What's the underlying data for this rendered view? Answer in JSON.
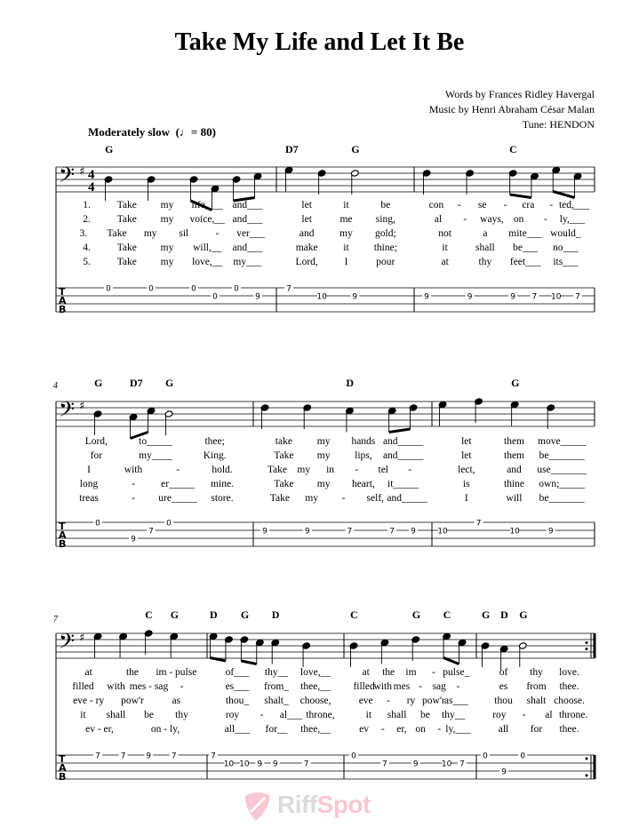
{
  "title": "Take My Life and Let It Be",
  "credits": {
    "words": "Words by Frances Ridley Havergal",
    "music": "Music by Henri Abraham César Malan",
    "tune": "Tune: HENDON"
  },
  "tempo": {
    "label": "Moderately slow",
    "bpm_text": "= 80",
    "bpm": 80
  },
  "clef": "bass",
  "key_signature": "G major (1 sharp)",
  "time_signature": "4/4",
  "tab_label": [
    "T",
    "A",
    "B"
  ],
  "watermark": {
    "part1": "Riff",
    "part2": "Spot"
  },
  "systems": [
    {
      "measure_number": "",
      "chords": [
        {
          "label": "G",
          "measure": 0,
          "beat": 0
        },
        {
          "label": "D7",
          "measure": 1,
          "beat": 0
        },
        {
          "label": "G",
          "measure": 1,
          "beat": 2
        },
        {
          "label": "C",
          "measure": 2,
          "beat": 2
        }
      ],
      "measures": [
        {
          "notes": [
            {
              "pitch": "G3",
              "dur": "q",
              "beat": 0
            },
            {
              "pitch": "G3",
              "dur": "q",
              "beat": 1
            },
            {
              "pitch": "G3",
              "dur": "e",
              "beat": 2
            },
            {
              "pitch": "D3",
              "dur": "e",
              "beat": 2.5
            },
            {
              "pitch": "G3",
              "dur": "e",
              "beat": 3
            },
            {
              "pitch": "A3",
              "dur": "e",
              "beat": 3.5
            }
          ],
          "tab": [
            {
              "string": 1,
              "fret": "0",
              "beat": 0
            },
            {
              "string": 1,
              "fret": "0",
              "beat": 1
            },
            {
              "string": 1,
              "fret": "0",
              "beat": 2
            },
            {
              "string": 2,
              "fret": "0",
              "beat": 2.5
            },
            {
              "string": 1,
              "fret": "0",
              "beat": 3
            },
            {
              "string": 2,
              "fret": "9",
              "beat": 3.5
            }
          ],
          "lyrics": [
            [
              "1.",
              "Take",
              "my",
              "life,___",
              "and___"
            ],
            [
              "2.",
              "Take",
              "my",
              "voice,__",
              "and___"
            ],
            [
              "3.",
              "Take",
              "my",
              "sil",
              "-",
              "ver___"
            ],
            [
              "4.",
              "Take",
              "my",
              "will,__",
              "and___"
            ],
            [
              "5.",
              "Take",
              "my",
              "love,__",
              "my___"
            ]
          ]
        },
        {
          "notes": [
            {
              "pitch": "C4",
              "dur": "q",
              "beat": 0
            },
            {
              "pitch": "B3",
              "dur": "q",
              "beat": 1
            },
            {
              "pitch": "B3",
              "dur": "h",
              "beat": 2
            }
          ],
          "tab": [
            {
              "string": 1,
              "fret": "7",
              "beat": 0
            },
            {
              "string": 2,
              "fret": "10",
              "beat": 1
            },
            {
              "string": 2,
              "fret": "9",
              "beat": 2
            }
          ],
          "lyrics": [
            [
              "let",
              "it",
              "be"
            ],
            [
              "let",
              "me",
              "sing,"
            ],
            [
              "and",
              "my",
              "gold;"
            ],
            [
              "make",
              "it",
              "thine;"
            ],
            [
              "Lord,",
              "I",
              "pour"
            ]
          ]
        },
        {
          "notes": [
            {
              "pitch": "B3",
              "dur": "q",
              "beat": 0
            },
            {
              "pitch": "B3",
              "dur": "q",
              "beat": 1
            },
            {
              "pitch": "B3",
              "dur": "e",
              "beat": 2
            },
            {
              "pitch": "A3",
              "dur": "e",
              "beat": 2.5
            },
            {
              "pitch": "C4",
              "dur": "e",
              "beat": 3
            },
            {
              "pitch": "A3",
              "dur": "e",
              "beat": 3.5
            }
          ],
          "tab": [
            {
              "string": 2,
              "fret": "9",
              "beat": 0
            },
            {
              "string": 2,
              "fret": "9",
              "beat": 1
            },
            {
              "string": 2,
              "fret": "9",
              "beat": 2
            },
            {
              "string": 2,
              "fret": "7",
              "beat": 2.5
            },
            {
              "string": 2,
              "fret": "10",
              "beat": 3
            },
            {
              "string": 2,
              "fret": "7",
              "beat": 3.5
            }
          ],
          "lyrics": [
            [
              "con",
              "-",
              "se",
              "-",
              "cra",
              "-",
              "ted,___"
            ],
            [
              "al",
              "-",
              "ways,",
              "on",
              "-",
              "ly,___"
            ],
            [
              "not",
              "a",
              "mite___",
              "would_"
            ],
            [
              "it",
              "shall",
              "be___",
              "no___"
            ],
            [
              "at",
              "thy",
              "feet___",
              "its___"
            ]
          ]
        }
      ]
    },
    {
      "measure_number": "4",
      "chords": [
        {
          "label": "G",
          "measure": 0,
          "beat": 0
        },
        {
          "label": "D7",
          "measure": 0,
          "beat": 1
        },
        {
          "label": "G",
          "measure": 0,
          "beat": 2
        },
        {
          "label": "D",
          "measure": 1,
          "beat": 2
        },
        {
          "label": "G",
          "measure": 2,
          "beat": 2
        }
      ],
      "measures": [
        {
          "notes": [
            {
              "pitch": "G3",
              "dur": "q",
              "beat": 0
            },
            {
              "pitch": "F#3",
              "dur": "e",
              "beat": 1
            },
            {
              "pitch": "A3",
              "dur": "e",
              "beat": 1.5
            },
            {
              "pitch": "G3",
              "dur": "h",
              "beat": 2
            }
          ],
          "tab": [
            {
              "string": 1,
              "fret": "0",
              "beat": 0
            },
            {
              "string": 3,
              "fret": "9",
              "beat": 1
            },
            {
              "string": 2,
              "fret": "7",
              "beat": 1.5
            },
            {
              "string": 1,
              "fret": "0",
              "beat": 2
            }
          ],
          "lyrics": [
            [
              "Lord,",
              "to_____",
              "thee;"
            ],
            [
              "for",
              "my____",
              "King."
            ],
            [
              "I",
              "with",
              "-",
              "hold."
            ],
            [
              "long",
              "-",
              "er_____",
              "mine."
            ],
            [
              "treas",
              "-",
              "ure_____",
              "store."
            ]
          ]
        },
        {
          "notes": [
            {
              "pitch": "B3",
              "dur": "q",
              "beat": 0
            },
            {
              "pitch": "B3",
              "dur": "q",
              "beat": 1
            },
            {
              "pitch": "A3",
              "dur": "q",
              "beat": 2
            },
            {
              "pitch": "A3",
              "dur": "e",
              "beat": 3
            },
            {
              "pitch": "B3",
              "dur": "e",
              "beat": 3.5
            }
          ],
          "tab": [
            {
              "string": 2,
              "fret": "9",
              "beat": 0
            },
            {
              "string": 2,
              "fret": "9",
              "beat": 1
            },
            {
              "string": 2,
              "fret": "7",
              "beat": 2
            },
            {
              "string": 2,
              "fret": "7",
              "beat": 3
            },
            {
              "string": 2,
              "fret": "9",
              "beat": 3.5
            }
          ],
          "lyrics": [
            [
              "take",
              "my",
              "hands",
              "and_____"
            ],
            [
              "Take",
              "my",
              "lips,",
              "and_____"
            ],
            [
              "Take",
              "my",
              "in",
              "-",
              "tel",
              "-"
            ],
            [
              "Take",
              "my",
              "heart,",
              "it_____"
            ],
            [
              "Take",
              "my",
              "-",
              "self,",
              "and_____"
            ]
          ]
        },
        {
          "notes": [
            {
              "pitch": "C4",
              "dur": "q",
              "beat": 0
            },
            {
              "pitch": "D4",
              "dur": "q",
              "beat": 1
            },
            {
              "pitch": "C4",
              "dur": "q",
              "beat": 2
            },
            {
              "pitch": "B3",
              "dur": "q",
              "beat": 3
            }
          ],
          "tab": [
            {
              "string": 2,
              "fret": "10",
              "beat": 0
            },
            {
              "string": 1,
              "fret": "7",
              "beat": 1
            },
            {
              "string": 2,
              "fret": "10",
              "beat": 2
            },
            {
              "string": 2,
              "fret": "9",
              "beat": 3
            }
          ],
          "lyrics": [
            [
              "let",
              "them",
              "move_____"
            ],
            [
              "let",
              "them",
              "be_______"
            ],
            [
              "lect,",
              "and",
              "use_______"
            ],
            [
              "is",
              "thine",
              "own;_____"
            ],
            [
              "I",
              "will",
              "be_______"
            ]
          ]
        }
      ]
    },
    {
      "measure_number": "7",
      "chords": [
        {
          "label": "C",
          "measure": 0,
          "beat": 2
        },
        {
          "label": "G",
          "measure": 0,
          "beat": 3
        },
        {
          "label": "D",
          "measure": 1,
          "beat": 0
        },
        {
          "label": "G",
          "measure": 1,
          "beat": 1
        },
        {
          "label": "D",
          "measure": 1,
          "beat": 2
        },
        {
          "label": "C",
          "measure": 2,
          "beat": 0
        },
        {
          "label": "G",
          "measure": 2,
          "beat": 2
        },
        {
          "label": "C",
          "measure": 2,
          "beat": 3
        },
        {
          "label": "G",
          "measure": 3,
          "beat": 0
        },
        {
          "label": "D",
          "measure": 3,
          "beat": 1
        },
        {
          "label": "G",
          "measure": 3,
          "beat": 2
        }
      ],
      "measures": [
        {
          "notes": [
            {
              "pitch": "C4",
              "dur": "q",
              "beat": 0
            },
            {
              "pitch": "C4",
              "dur": "q",
              "beat": 1
            },
            {
              "pitch": "D4",
              "dur": "q",
              "beat": 2
            },
            {
              "pitch": "C4",
              "dur": "q",
              "beat": 3
            }
          ],
          "tab": [
            {
              "string": 1,
              "fret": "7",
              "beat": 0
            },
            {
              "string": 1,
              "fret": "7",
              "beat": 1
            },
            {
              "string": 1,
              "fret": "9",
              "beat": 2
            },
            {
              "string": 1,
              "fret": "7",
              "beat": 3
            }
          ],
          "lyrics": [
            [
              "at",
              "the",
              "im - pulse"
            ],
            [
              "filled",
              "with",
              "mes - sag",
              "-"
            ],
            [
              "eve - ry",
              "pow'r",
              "as"
            ],
            [
              "it",
              "shall",
              "be",
              "thy"
            ],
            [
              "ev - er,",
              "on - ly,"
            ]
          ]
        },
        {
          "notes": [
            {
              "pitch": "C4",
              "dur": "e",
              "beat": 0
            },
            {
              "pitch": "B3",
              "dur": "e",
              "beat": 0.5
            },
            {
              "pitch": "B3",
              "dur": "e",
              "beat": 1
            },
            {
              "pitch": "A3",
              "dur": "e",
              "beat": 1.5
            },
            {
              "pitch": "A3",
              "dur": "q",
              "beat": 2
            },
            {
              "pitch": "G3",
              "dur": "q",
              "beat": 3
            }
          ],
          "tab": [
            {
              "string": 1,
              "fret": "7",
              "beat": 0
            },
            {
              "string": 2,
              "fret": "10",
              "beat": 0.5
            },
            {
              "string": 2,
              "fret": "10",
              "beat": 1
            },
            {
              "string": 2,
              "fret": "9",
              "beat": 1.5
            },
            {
              "string": 2,
              "fret": "9",
              "beat": 2
            },
            {
              "string": 2,
              "fret": "7",
              "beat": 3
            }
          ],
          "lyrics": [
            [
              "of___",
              "thy__",
              "love,__"
            ],
            [
              "es___",
              "from_",
              "thee,__"
            ],
            [
              "thou_",
              "shalt_",
              "choose,"
            ],
            [
              "roy",
              "-",
              "al___",
              "throne,"
            ],
            [
              "all___",
              "for__",
              "thee,__"
            ]
          ]
        },
        {
          "notes": [
            {
              "pitch": "G3",
              "dur": "q",
              "beat": 0
            },
            {
              "pitch": "A3",
              "dur": "q",
              "beat": 1
            },
            {
              "pitch": "B3",
              "dur": "q",
              "beat": 2
            },
            {
              "pitch": "C4",
              "dur": "e",
              "beat": 3
            },
            {
              "pitch": "A3",
              "dur": "e",
              "beat": 3.5
            }
          ],
          "tab": [
            {
              "string": 1,
              "fret": "0",
              "beat": 0
            },
            {
              "string": 2,
              "fret": "7",
              "beat": 1
            },
            {
              "string": 2,
              "fret": "9",
              "beat": 2
            },
            {
              "string": 2,
              "fret": "10",
              "beat": 3
            },
            {
              "string": 2,
              "fret": "7",
              "beat": 3.5
            }
          ],
          "lyrics": [
            [
              "at",
              "the",
              "im",
              "-",
              "pulse_"
            ],
            [
              "filled",
              "with",
              "mes",
              "-",
              "sag",
              "-"
            ],
            [
              "eve",
              "-",
              "ry",
              "pow'r",
              "as___"
            ],
            [
              "it",
              "shall",
              "be",
              "thy__"
            ],
            [
              "ev",
              "-",
              "er,",
              "on",
              "-",
              "ly,___"
            ]
          ]
        },
        {
          "notes": [
            {
              "pitch": "G3",
              "dur": "q",
              "beat": 0
            },
            {
              "pitch": "F#3",
              "dur": "q",
              "beat": 1
            },
            {
              "pitch": "G3",
              "dur": "h",
              "beat": 2
            }
          ],
          "tab": [
            {
              "string": 1,
              "fret": "0",
              "beat": 0
            },
            {
              "string": 3,
              "fret": "9",
              "beat": 1
            },
            {
              "string": 1,
              "fret": "0",
              "beat": 2
            }
          ],
          "lyrics": [
            [
              "of",
              "thy",
              "love."
            ],
            [
              "es",
              "from",
              "thee."
            ],
            [
              "thou",
              "shalt",
              "choose."
            ],
            [
              "roy",
              "-",
              "al",
              "throne."
            ],
            [
              "all",
              "for",
              "thee."
            ]
          ]
        }
      ]
    }
  ]
}
